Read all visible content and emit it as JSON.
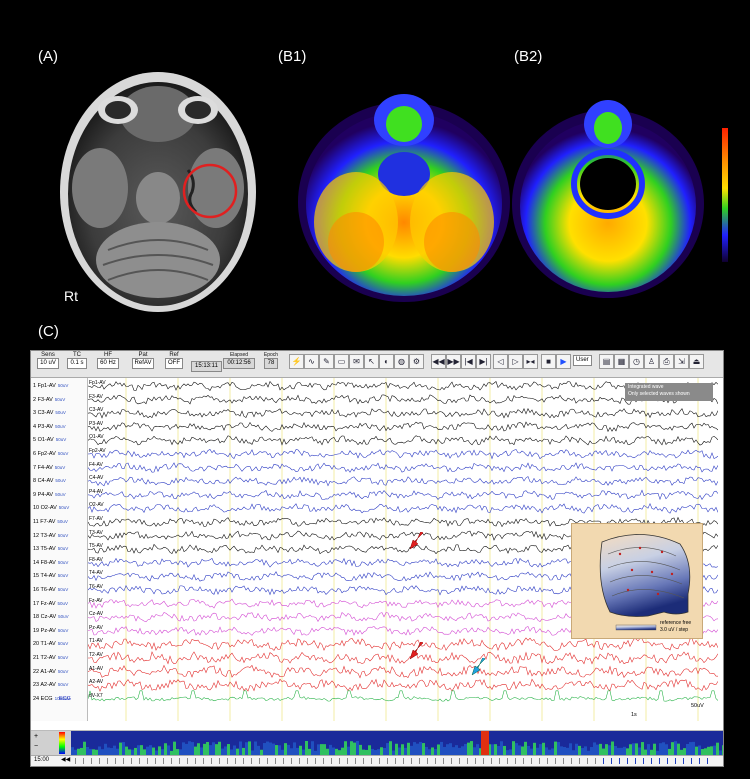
{
  "labels": {
    "a": "(A)",
    "b1": "(B1)",
    "b2": "(B2)",
    "c": "(C)",
    "rt": "Rt"
  },
  "toolbar": {
    "sens_h": "Sens",
    "sens_v": "10 uV",
    "tc_h": "TC",
    "tc_v": "0.1 s",
    "hf_h": "HF",
    "hf_v": "60 Hz",
    "pat_h": "Pat",
    "pat_v": "RefAV",
    "ref_h": "Ref",
    "ref_v": "OFF",
    "time_v": "15:13:11",
    "elapsed_h": "Elapsed",
    "elapsed_v": "00:12:56",
    "epoch_h": "Epoch",
    "epoch_v": "78",
    "user_v": "User"
  },
  "channels": [
    {
      "n": "1 Fp1-AV",
      "t": "Fp1-AV",
      "color": "#000000"
    },
    {
      "n": "2 F3-AV",
      "t": "F3-AV",
      "color": "#000000"
    },
    {
      "n": "3 C3-AV",
      "t": "C3-AV",
      "color": "#000000"
    },
    {
      "n": "4 P3-AV",
      "t": "P3-AV",
      "color": "#000000"
    },
    {
      "n": "5 O1-AV",
      "t": "O1-AV",
      "color": "#000000"
    },
    {
      "n": "6 Fp2-AV",
      "t": "Fp2-AV",
      "color": "#2030c0"
    },
    {
      "n": "7 F4-AV",
      "t": "F4-AV",
      "color": "#2030c0"
    },
    {
      "n": "8 C4-AV",
      "t": "C4-AV",
      "color": "#2030c0"
    },
    {
      "n": "9 P4-AV",
      "t": "P4-AV",
      "color": "#2030c0"
    },
    {
      "n": "10 O2-AV",
      "t": "O2-AV",
      "color": "#2030c0"
    },
    {
      "n": "11 F7-AV",
      "t": "F7-AV",
      "color": "#000000"
    },
    {
      "n": "12 T3-AV",
      "t": "T3-AV",
      "color": "#000000"
    },
    {
      "n": "13 T5-AV",
      "t": "T5-AV",
      "color": "#000000"
    },
    {
      "n": "14 F8-AV",
      "t": "F8-AV",
      "color": "#2030c0"
    },
    {
      "n": "15 T4-AV",
      "t": "T4-AV",
      "color": "#2030c0"
    },
    {
      "n": "16 T6-AV",
      "t": "T6-AV",
      "color": "#2030c0"
    },
    {
      "n": "17 Fz-AV",
      "t": "Fz-AV",
      "color": "#d040d0"
    },
    {
      "n": "18 Cz-AV",
      "t": "Cz-AV",
      "color": "#d040d0"
    },
    {
      "n": "19 Pz-AV",
      "t": "Pz-AV",
      "color": "#d040d0"
    },
    {
      "n": "20 T1-AV",
      "t": "T1-AV",
      "color": "#e02020"
    },
    {
      "n": "21 T2-AV",
      "t": "T2-AV",
      "color": "#e02020"
    },
    {
      "n": "22 A1-AV",
      "t": "A1-AV",
      "color": "#e02020"
    },
    {
      "n": "23 A2-AV",
      "t": "A2-AV",
      "color": "#e02020"
    },
    {
      "n": "24 ECG",
      "t": "dV-X7",
      "color": "#20b040"
    }
  ],
  "units": {
    "uv": "50uV",
    "ecg": "1000uV",
    "sec": "1s",
    "ecg_lab": "ECG"
  },
  "notice": {
    "l1": "Integrated wave",
    "l2": "Only selected waves shown"
  },
  "topo": {
    "ref": "reference free",
    "step": "3.0 uV / step"
  },
  "timeline": {
    "t": "15:00"
  },
  "colors": {
    "red_arrow": "#e02020",
    "blue_arrow": "#20a0e0",
    "circle": "#e02020"
  }
}
